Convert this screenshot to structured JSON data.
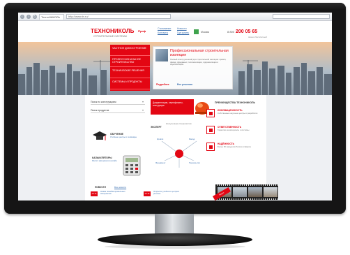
{
  "browser": {
    "url": "http://www.tn.ru/",
    "tab_title": "ТехноНИКОЛЬ",
    "search_placeholder": ""
  },
  "header": {
    "logo": "ТЕХНОНИКОЛЬ",
    "logo_sub": "СТРОИТЕЛЬНЫЕ СИСТЕМЫ",
    "tag": "Проф",
    "link_1": "О компании",
    "link_2": "Контакты",
    "link_3": "Новости",
    "link_4": "Где купить",
    "region": "Москва",
    "phone_prefix": "8 800",
    "phone": "200 05 65",
    "phone_sub": "звонок бесплатный"
  },
  "hero": {
    "menu": [
      "Частное домостроение",
      "Профессиональное строительство",
      "Технические решения",
      "Системы и продукты"
    ],
    "card_title": "Профессиональная строительная изоляция",
    "card_text": "Полный спектр решений для строительной изоляции: кровля, фасад, фундамент, теплоизоляция, гидроизоляция и звукоизоляция.",
    "card_btn_1": "Подробнее",
    "card_btn_2": "Все решения"
  },
  "content": {
    "select_1": "Поиск по конструкциям",
    "select_2": "Поиск продуктов",
    "promo": "Документация, сертификаты, инструкции",
    "adv_title": "Преимущества ТехноНИКОЛЬ",
    "advantages": [
      {
        "head": "Инновационность",
        "desc": "Собственные научные центры и разработки"
      },
      {
        "head": "Ответственность",
        "desc": "Гарантия на материалы и системы"
      },
      {
        "head": "Надёжность",
        "desc": "Более 50 заводов в России и Европе"
      }
    ],
    "education_label": "Обучение",
    "education_desc": "Учебные центры и семинары",
    "calc_label": "Калькуляторы",
    "calc_desc": "Расчёт материалов онлайн",
    "expert_label": "Эксперт",
    "expert_desc": "Консультация специалистов",
    "diagram_nodes": [
      "Кровля",
      "Фасад",
      "Фундамент",
      "Перекрытия"
    ],
    "news_label": "Новости",
    "news_all": "Все новости",
    "news": [
      {
        "date": "15.11",
        "text": "Новая линейка кровельных материалов"
      },
      {
        "date": "12.11",
        "text": "Открытие учебного центра в регионе"
      }
    ],
    "video_ribbon": "Видео"
  },
  "colors": {
    "brand_red": "#e30613",
    "link_blue": "#3a6fb0"
  }
}
